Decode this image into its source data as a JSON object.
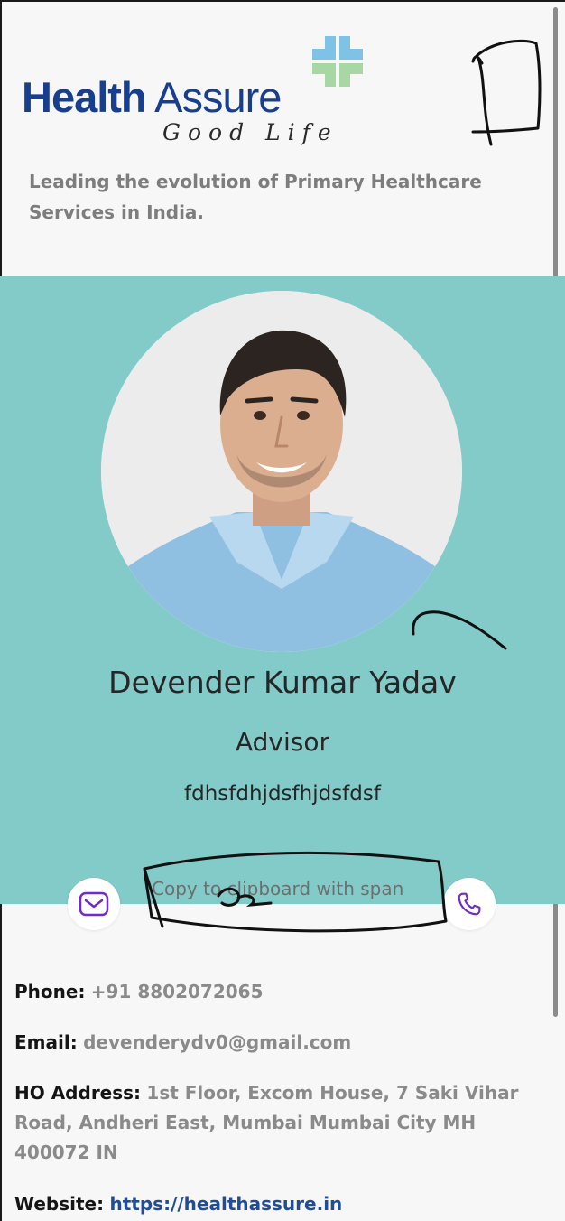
{
  "brand": {
    "name_bold": "Health",
    "name_regular": " Assure",
    "tagline": "Good Life",
    "colors": {
      "navy": "#183f8d",
      "cross_blue": "#7ec3e5",
      "cross_green": "#a7d7a3",
      "banner_teal": "#82cbc9"
    }
  },
  "header": {
    "description": "Leading the evolution of Primary Healthcare Services in India."
  },
  "profile": {
    "name": "Devender Kumar Yadav",
    "role": "Advisor",
    "note": "fdhsfdhjdsfhjdsfdsf"
  },
  "actions": {
    "copy_label": "Copy to clipboard with span",
    "email_icon": "envelope-icon",
    "phone_icon": "phone-icon",
    "icon_color": "#6f2cc9"
  },
  "contact": {
    "phone_label": "Phone:",
    "phone_value": "+91 8802072065",
    "email_label": "Email:",
    "email_value": "devenderydv0@gmail.com",
    "address_label": "HO Address:",
    "address_value": "1st Floor, Excom House, 7 Saki Vihar Road, Andheri East, Mumbai Mumbai City MH 400072 IN",
    "website_label": "Website:",
    "website_value": "https://healthassure.in"
  }
}
